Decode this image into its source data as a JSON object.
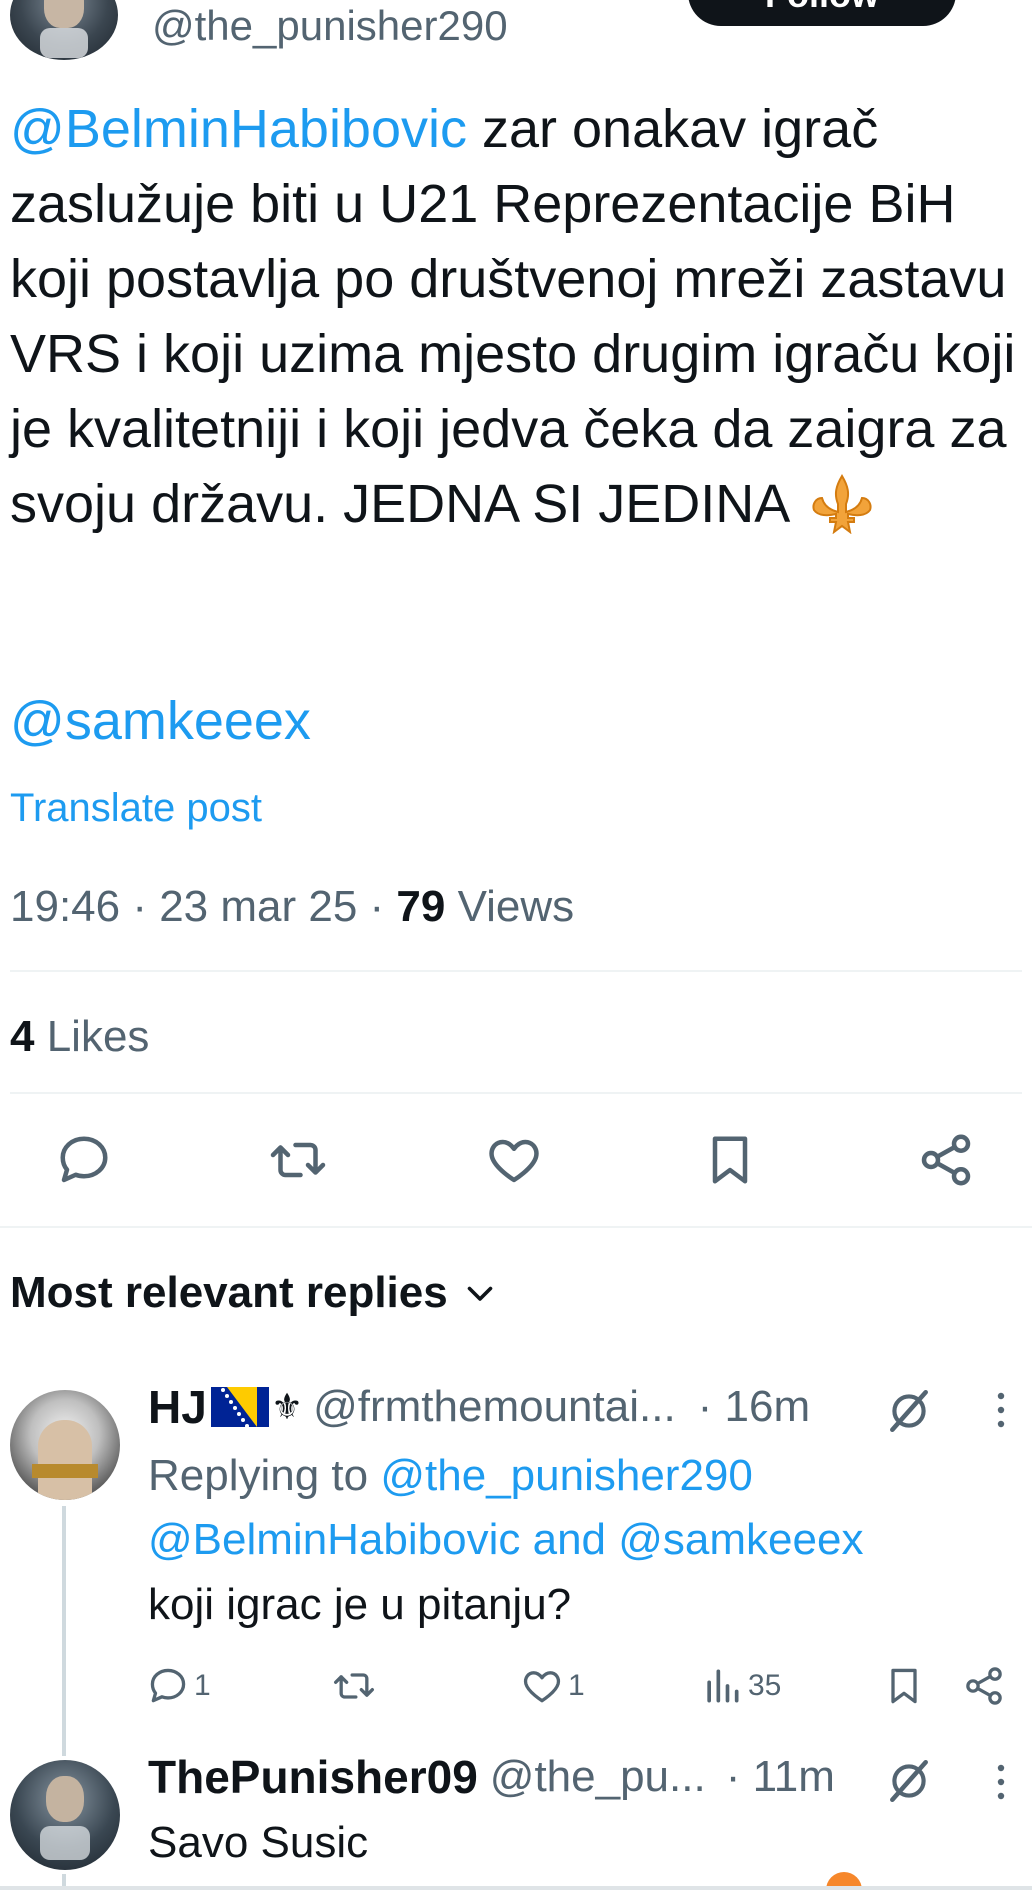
{
  "header": {
    "handle": "@the_punisher290",
    "follow_label": "Follow"
  },
  "tweet": {
    "mention1": "@BelminHabibovic",
    "text": " zar onakav igrač zaslužuje biti u U21 Reprezentacije BiH koji postavlja po društvenoj mreži zastavu VRS i koji uzima mjesto drugim igraču koji je kvalitetniji i koji jedva čeka da zaigra za svoju državu. JEDNA SI JEDINA ",
    "mention2": "@samkeeex",
    "translate_label": "Translate post",
    "time_date": "19:46 · 23 mar 25 · ",
    "views_count": "79",
    "views_label": " Views",
    "likes_count": "4",
    "likes_label": " Likes"
  },
  "actions": [
    {
      "icon": "reply-icon"
    },
    {
      "icon": "retweet-icon"
    },
    {
      "icon": "like-icon"
    },
    {
      "icon": "bookmark-icon"
    },
    {
      "icon": "share-icon"
    }
  ],
  "replies_header": "Most relevant replies",
  "replies": [
    {
      "name": "HJ",
      "name_suffix": "⚜",
      "handle": "@frmthemountai...",
      "time": "· 16m",
      "replying_prefix": "Replying to ",
      "replying_to_1": "@the_punisher290",
      "replying_to_2": "@BelminHabibovic",
      "replying_and": " and ",
      "replying_to_3": "@samkeeex",
      "text": "koji igrac je u pitanju?",
      "reply_count": "1",
      "like_count": "1",
      "views_count": "35"
    },
    {
      "name": "ThePunisher09",
      "handle": "@the_pu...",
      "time": "· 11m",
      "text": "Savo Susic"
    }
  ],
  "colors": {
    "accent": "#1d9bf0",
    "text": "#0f1419",
    "secondary": "#536471",
    "divider": "#eff3f4"
  }
}
